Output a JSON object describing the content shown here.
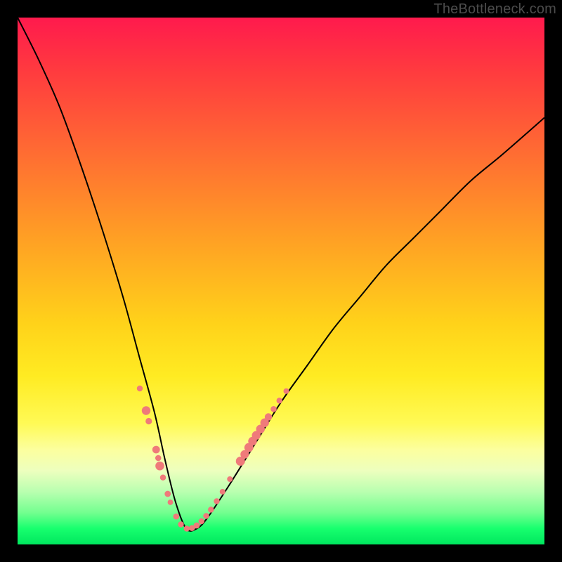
{
  "watermark": "TheBottleneck.com",
  "chart_data": {
    "type": "line",
    "title": "",
    "xlabel": "",
    "ylabel": "",
    "xlim": [
      0,
      100
    ],
    "ylim": [
      0,
      100
    ],
    "background_gradient": {
      "top_color": "#ff1a4d",
      "bottom_color": "#00e75e",
      "description": "vertical red-to-green gradient indicating bottleneck severity"
    },
    "series": [
      {
        "name": "bottleneck-curve",
        "description": "V-shaped curve, minimum near x≈32, left arm steep from upper-left, right arm shallow to upper-right",
        "x": [
          0,
          4,
          8,
          12,
          16,
          20,
          23,
          26,
          28,
          30,
          32,
          34,
          36,
          40,
          45,
          50,
          55,
          60,
          65,
          70,
          75,
          80,
          86,
          92,
          100
        ],
        "values": [
          100,
          92,
          83,
          72,
          60,
          47,
          36,
          25,
          16,
          8,
          3,
          3,
          5,
          11,
          19,
          27,
          34,
          41,
          47,
          53,
          58,
          63,
          69,
          74,
          81
        ]
      }
    ],
    "markers": {
      "color": "#ef7a7a",
      "radius_range": [
        3.5,
        7
      ],
      "points": [
        {
          "x": 23.2,
          "y": 29.6,
          "r": 4.2
        },
        {
          "x": 24.4,
          "y": 25.4,
          "r": 6.2
        },
        {
          "x": 24.9,
          "y": 23.4,
          "r": 4.6
        },
        {
          "x": 26.3,
          "y": 18.0,
          "r": 5.4
        },
        {
          "x": 26.7,
          "y": 16.4,
          "r": 4.3
        },
        {
          "x": 27.0,
          "y": 14.9,
          "r": 6.3
        },
        {
          "x": 27.6,
          "y": 12.7,
          "r": 4.2
        },
        {
          "x": 28.5,
          "y": 9.6,
          "r": 4.4
        },
        {
          "x": 29.0,
          "y": 8.0,
          "r": 3.9
        },
        {
          "x": 30.1,
          "y": 5.3,
          "r": 4.3
        },
        {
          "x": 31.0,
          "y": 3.8,
          "r": 4.2
        },
        {
          "x": 32.1,
          "y": 3.0,
          "r": 4.2
        },
        {
          "x": 33.1,
          "y": 3.1,
          "r": 4.2
        },
        {
          "x": 34.0,
          "y": 3.6,
          "r": 4.4
        },
        {
          "x": 34.9,
          "y": 4.4,
          "r": 4.2
        },
        {
          "x": 35.8,
          "y": 5.4,
          "r": 4.2
        },
        {
          "x": 36.7,
          "y": 6.6,
          "r": 4.2
        },
        {
          "x": 37.8,
          "y": 8.2,
          "r": 4.2
        },
        {
          "x": 38.9,
          "y": 10.0,
          "r": 4.0
        },
        {
          "x": 40.3,
          "y": 12.4,
          "r": 4.0
        },
        {
          "x": 42.3,
          "y": 15.8,
          "r": 6.5
        },
        {
          "x": 43.1,
          "y": 17.1,
          "r": 6.0
        },
        {
          "x": 43.9,
          "y": 18.4,
          "r": 6.4
        },
        {
          "x": 44.6,
          "y": 19.6,
          "r": 6.2
        },
        {
          "x": 45.3,
          "y": 20.7,
          "r": 6.2
        },
        {
          "x": 46.1,
          "y": 21.9,
          "r": 6.2
        },
        {
          "x": 46.9,
          "y": 23.1,
          "r": 6.2
        },
        {
          "x": 47.6,
          "y": 24.2,
          "r": 5.2
        },
        {
          "x": 48.6,
          "y": 25.7,
          "r": 4.3
        },
        {
          "x": 49.7,
          "y": 27.3,
          "r": 4.2
        },
        {
          "x": 51.0,
          "y": 29.1,
          "r": 4.0
        }
      ]
    }
  }
}
